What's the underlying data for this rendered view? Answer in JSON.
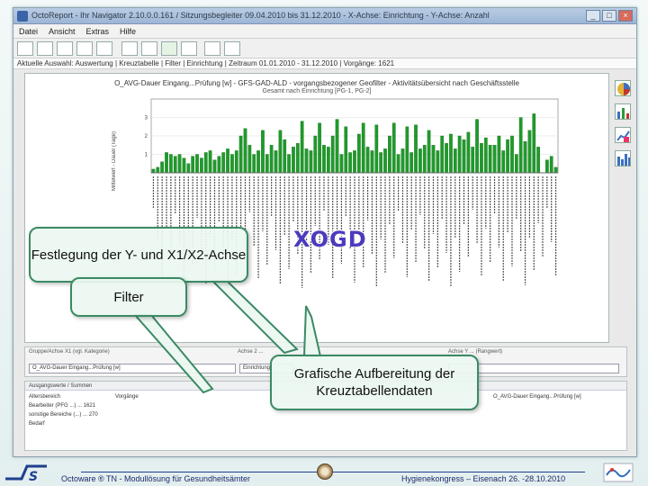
{
  "app": {
    "title": "OctoReport - Ihr Navigator 2.10.0.0.161 / Sitzungsbegleiter 09.04.2010 bis 31.12.2010 - X-Achse: Einrichtung - Y-Achse: Anzahl",
    "menu": [
      "Datei",
      "Ansicht",
      "Extras",
      "Hilfe"
    ],
    "breadcrumb": "Aktuelle Auswahl: Auswertung | Kreuztabelle | Filter | Einrichtung | Zeitraum 01.01.2010 - 31.12.2010 | Vorgänge: 1621"
  },
  "chart": {
    "title": "O_AVG-Dauer Eingang...Prüfung [w] - GFS-GAD-ALD - vorgangsbezogener Geofilter - Aktivitätsübersicht nach Geschäftsstelle",
    "subtitle": "Gesamt nach Einrichtung [PG-1, PG-2]",
    "ylabel": "Mittelwert - Dauer (Tage)"
  },
  "chart_data": {
    "type": "bar",
    "ylim": [
      0,
      4
    ],
    "ytick_labels": [
      "1",
      "2",
      "3"
    ],
    "values": [
      0.2,
      0.3,
      0.6,
      1.1,
      1.0,
      0.9,
      1.0,
      0.8,
      0.5,
      0.9,
      1.0,
      0.8,
      1.1,
      1.2,
      0.7,
      0.9,
      1.1,
      1.3,
      1.0,
      1.2,
      2.0,
      2.4,
      1.5,
      1.0,
      1.2,
      2.3,
      1.0,
      1.5,
      1.2,
      2.3,
      1.8,
      1.0,
      1.4,
      1.6,
      2.8,
      1.3,
      1.2,
      2.0,
      2.7,
      1.5,
      1.4,
      2.0,
      2.9,
      1.0,
      2.5,
      1.1,
      1.2,
      2.1,
      2.7,
      1.4,
      1.2,
      2.6,
      1.1,
      1.3,
      2.0,
      2.7,
      1.0,
      1.3,
      2.5,
      1.1,
      2.6,
      1.3,
      1.5,
      2.3,
      1.5,
      1.2,
      2.0,
      1.6,
      2.1,
      1.3,
      2.0,
      1.8,
      2.2,
      1.4,
      2.9,
      1.6,
      1.9,
      1.5,
      1.5,
      2.0,
      1.2,
      1.8,
      2.0,
      1.0,
      3.0,
      1.7,
      2.3,
      3.2,
      1.4,
      0.0,
      0.7,
      0.9,
      0.3
    ]
  },
  "filter": {
    "left_label": "Gruppe/Achse X1 (vgl. Kategorie)",
    "left_value": "O_AVG-Dauer Eingang...Prüfung [w]",
    "middle_label": "Achse 2 ...",
    "middle_value": "Einrichtung",
    "right_label": "Achse Y ... (Rangwert)"
  },
  "pivot": {
    "header": "Ausgangswerte / Summen",
    "rows": [
      "Altersbereich",
      "Bearbeiter (PFG ...) ... 1621",
      "sonstige Bereiche (...) ... 270",
      "Bedarf"
    ],
    "col_label": "Vorgänge",
    "right_header": "O_AVG-Dauer Eingang...Prüfung [w]"
  },
  "callouts": {
    "axes": "Festlegung der Y- und X1/X2-Achse",
    "filter": "Filter",
    "pivot": "Grafische Aufbereitung der Kreuztabellendaten",
    "xogd": "XOGD"
  },
  "footer": {
    "left": "Octoware ® TN - Modullösung für Gesundheitsämter",
    "right": "Hygienekongress – Eisenach 26. -28.10.2010"
  },
  "colors": {
    "bar": "#1f9a2a",
    "callout_border": "#3b8a64",
    "xogd": "#4a3bbd",
    "footer_text": "#1a2a6a"
  }
}
